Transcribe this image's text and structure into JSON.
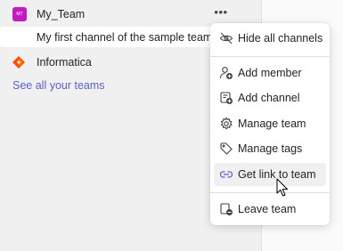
{
  "teams": [
    {
      "name": "My_Team",
      "avatar_initials": "MT",
      "avatar_color": "#c21bc2",
      "more_label": "•••",
      "channels": [
        {
          "name": "My first channel of the sample team"
        }
      ]
    },
    {
      "name": "Informatica",
      "icon": "informatica-logo-icon"
    }
  ],
  "see_all_label": "See all your teams",
  "context_menu": {
    "items": [
      {
        "label": "Hide all channels",
        "icon": "eye-off-icon"
      },
      {
        "label": "Add member",
        "icon": "person-add-icon"
      },
      {
        "label": "Add channel",
        "icon": "channel-add-icon"
      },
      {
        "label": "Manage team",
        "icon": "gear-icon"
      },
      {
        "label": "Manage tags",
        "icon": "tag-icon"
      },
      {
        "label": "Get link to team",
        "icon": "link-icon",
        "hovered": true
      },
      {
        "label": "Leave team",
        "icon": "leave-icon"
      }
    ]
  },
  "colors": {
    "accent": "#5b5fc7",
    "hover": "#f0f0f0"
  }
}
